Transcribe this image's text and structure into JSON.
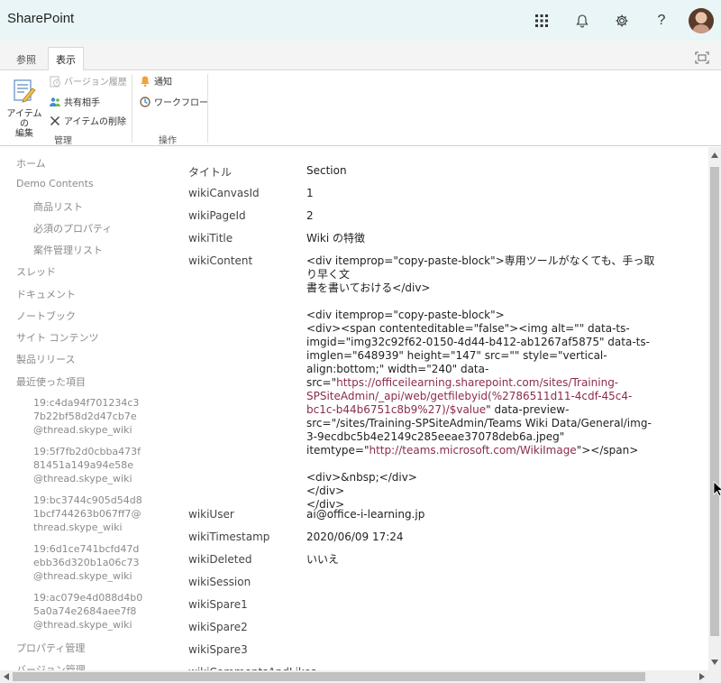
{
  "app": {
    "title": "SharePoint"
  },
  "suite": {
    "icons": [
      "app-launcher-icon",
      "bell-icon",
      "gear-icon",
      "help-icon"
    ],
    "help_glyph": "?"
  },
  "ribbon": {
    "tabs": [
      {
        "label": "参照"
      },
      {
        "label": "表示"
      }
    ],
    "edit_item": {
      "line1": "アイテムの",
      "line2": "編集"
    },
    "version_history": "バージョン履歴",
    "shared_with": "共有相手",
    "delete_item": "アイテムの削除",
    "alert": "通知",
    "workflow": "ワークフロー",
    "groups": {
      "manage": "管理",
      "actions": "操作"
    }
  },
  "leftnav": {
    "items": [
      {
        "label": "ホーム"
      },
      {
        "label": "Demo Contents"
      },
      {
        "label": "商品リスト"
      },
      {
        "label": "必須のプロパティ"
      },
      {
        "label": "案件管理リスト"
      },
      {
        "label": "スレッド"
      },
      {
        "label": "ドキュメント"
      },
      {
        "label": "ノートブック"
      },
      {
        "label": "サイト コンテンツ"
      },
      {
        "label": "製品リリース"
      },
      {
        "label": "最近使った項目"
      }
    ],
    "recent": [
      {
        "line1": "19:c4da94f701234c3",
        "line2": "7b22bf58d2d47cb7e",
        "line3": "@thread.skype_wiki"
      },
      {
        "line1": "19:5f7fb2d0cbba473f",
        "line2": "81451a149a94e58e",
        "line3": "@thread.skype_wiki"
      },
      {
        "line1": "19:bc3744c905d54d8",
        "line2": "1bcf744263b067ff7@",
        "line3": "thread.skype_wiki"
      },
      {
        "line1": "19:6d1ce741bcfd47d",
        "line2": "ebb36d320b1a06c73",
        "line3": "@thread.skype_wiki"
      },
      {
        "line1": "19:ac079e4d088d4b0",
        "line2": "5a0a74e2684aee7f8",
        "line3": "@thread.skype_wiki"
      }
    ],
    "property_mgmt": "プロパティ管理",
    "version_mgmt": "バージョン管理"
  },
  "fields": [
    {
      "label": "タイトル",
      "value": "Section"
    },
    {
      "label": "wikiCanvasId",
      "value": "1"
    },
    {
      "label": "wikiPageId",
      "value": "2"
    },
    {
      "label": "wikiTitle",
      "value": "Wiki の特徴"
    },
    {
      "label": "wikiContent"
    },
    {
      "label": "wikiUser",
      "value": "ai@office-i-learning.jp"
    },
    {
      "label": "wikiTimestamp",
      "value": "2020/06/09 17:24"
    },
    {
      "label": "wikiDeleted",
      "value": "いいえ"
    },
    {
      "label": "wikiSession",
      "value": ""
    },
    {
      "label": "wikiSpare1",
      "value": ""
    },
    {
      "label": "wikiSpare2",
      "value": ""
    },
    {
      "label": "wikiSpare3",
      "value": ""
    },
    {
      "label": "wikiCommentsAndLikes"
    }
  ],
  "wiki_content": {
    "p1_line1": "<div itemprop=\"copy-paste-block\">専用ツールがなくても、手っ取り早く文",
    "p1_line2": "書を書いておける</div>",
    "p2_line1": "<div itemprop=\"copy-paste-block\">",
    "p2_line2": "<div><span contenteditable=\"false\"><img alt=\"\" data-ts-",
    "p2_line3": "imgid=\"img32c92f62-0150-4d44-b412-ab1267af5875\" data-ts-",
    "p2_line4": "imglen=\"648939\" height=\"147\" src=\"\" style=\"vertical-",
    "p2_line5": "align:bottom;\" width=\"240\" data-",
    "p2_line6a": "src=\"",
    "p2_line6_link": "https://officeilearning.sharepoint.com/sites/Training-",
    "p2_line7_link": "SPSiteAdmin/_api/web/getfilebyid(%2786511d11-4cdf-45c4-",
    "p2_line8_link": "bc1c-b44b6751c8b9%27)/$value",
    "p2_line8b": "\" data-preview-",
    "p2_line9": "src=\"/sites/Training-SPSiteAdmin/Teams Wiki Data/General/img-",
    "p2_line10": "3-9ecdbc5b4e2149c285eeae37078deb6a.jpeg\"",
    "p2_line11a": "itemtype=\"",
    "p2_line11_link": "http://teams.microsoft.com/WikiImage",
    "p2_line11b": "\"></span>",
    "p3_line1": "<div>&nbsp;</div>",
    "p3_line2": "</div>",
    "p3_line3": "</div>"
  },
  "colors": {
    "suitebar": "#e9f5f6",
    "link": "#8b2c4d",
    "nav": "#8a8a8a"
  }
}
